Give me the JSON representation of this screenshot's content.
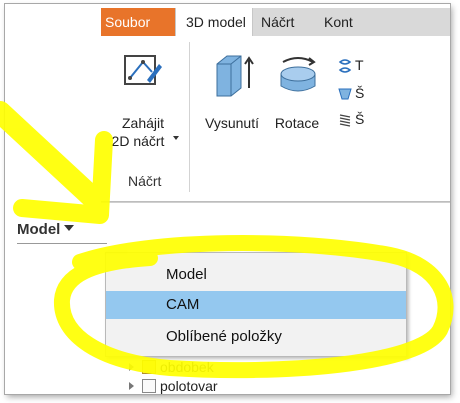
{
  "tabs": {
    "soubor": "Soubor",
    "model3d": "3D model",
    "nacrt": "Náčrt",
    "kont": "Kont"
  },
  "ribbon": {
    "start_sketch_line1": "Zahájit",
    "start_sketch_line2": "2D náčrt",
    "sketch_panel_title": "Náčrt",
    "extrude_label": "Vysunutí",
    "revolve_label": "Rotace",
    "cut_tool_1": "T",
    "cut_tool_2": "Š",
    "cut_tool_3": "Š"
  },
  "browser": {
    "dropdown_label": "Model",
    "menu_items": [
      "Model",
      "CAM",
      "Oblíbené položky"
    ],
    "selected_index": 1,
    "tree_rows": [
      "obdobek",
      "polotovar"
    ]
  },
  "colors": {
    "soubor_tab": "#e8742a",
    "selected_item": "#94c8ef",
    "highlighter": "#ffff00"
  }
}
